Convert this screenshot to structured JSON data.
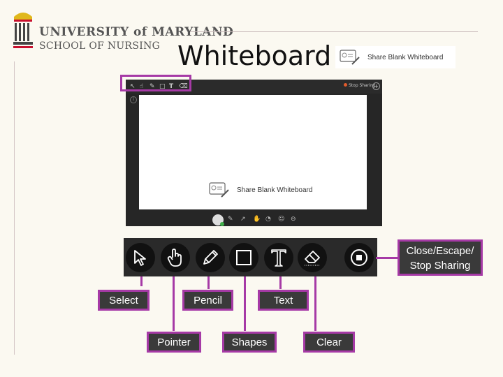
{
  "header": {
    "logo_line1": "UNIVERSITY of MARYLAND",
    "logo_line2": "SCHOOL OF NURSING",
    "title": "Whiteboard"
  },
  "share_chip": {
    "label": "Share Blank Whiteboard"
  },
  "whiteboard_screenshot": {
    "stop_sharing": "Stop Sharing",
    "canvas_label": "Share Blank Whiteboard"
  },
  "toolbar": {
    "tools": [
      {
        "id": "select",
        "icon": "arrow-cursor-icon"
      },
      {
        "id": "pointer",
        "icon": "hand-pointer-icon"
      },
      {
        "id": "pencil",
        "icon": "pencil-icon"
      },
      {
        "id": "shapes",
        "icon": "square-icon"
      },
      {
        "id": "text",
        "icon": "text-t-icon"
      },
      {
        "id": "clear",
        "icon": "eraser-icon"
      },
      {
        "id": "stop",
        "icon": "stop-circle-icon"
      }
    ]
  },
  "labels": {
    "select": "Select",
    "pointer": "Pointer",
    "pencil": "Pencil",
    "shapes": "Shapes",
    "text": "Text",
    "clear": "Clear",
    "close_line1": "Close/Escape/",
    "close_line2": "Stop Sharing"
  },
  "colors": {
    "accent": "#a63aa6",
    "toolbar_bg": "#2a2a2a",
    "label_bg": "#3a3a3a"
  }
}
